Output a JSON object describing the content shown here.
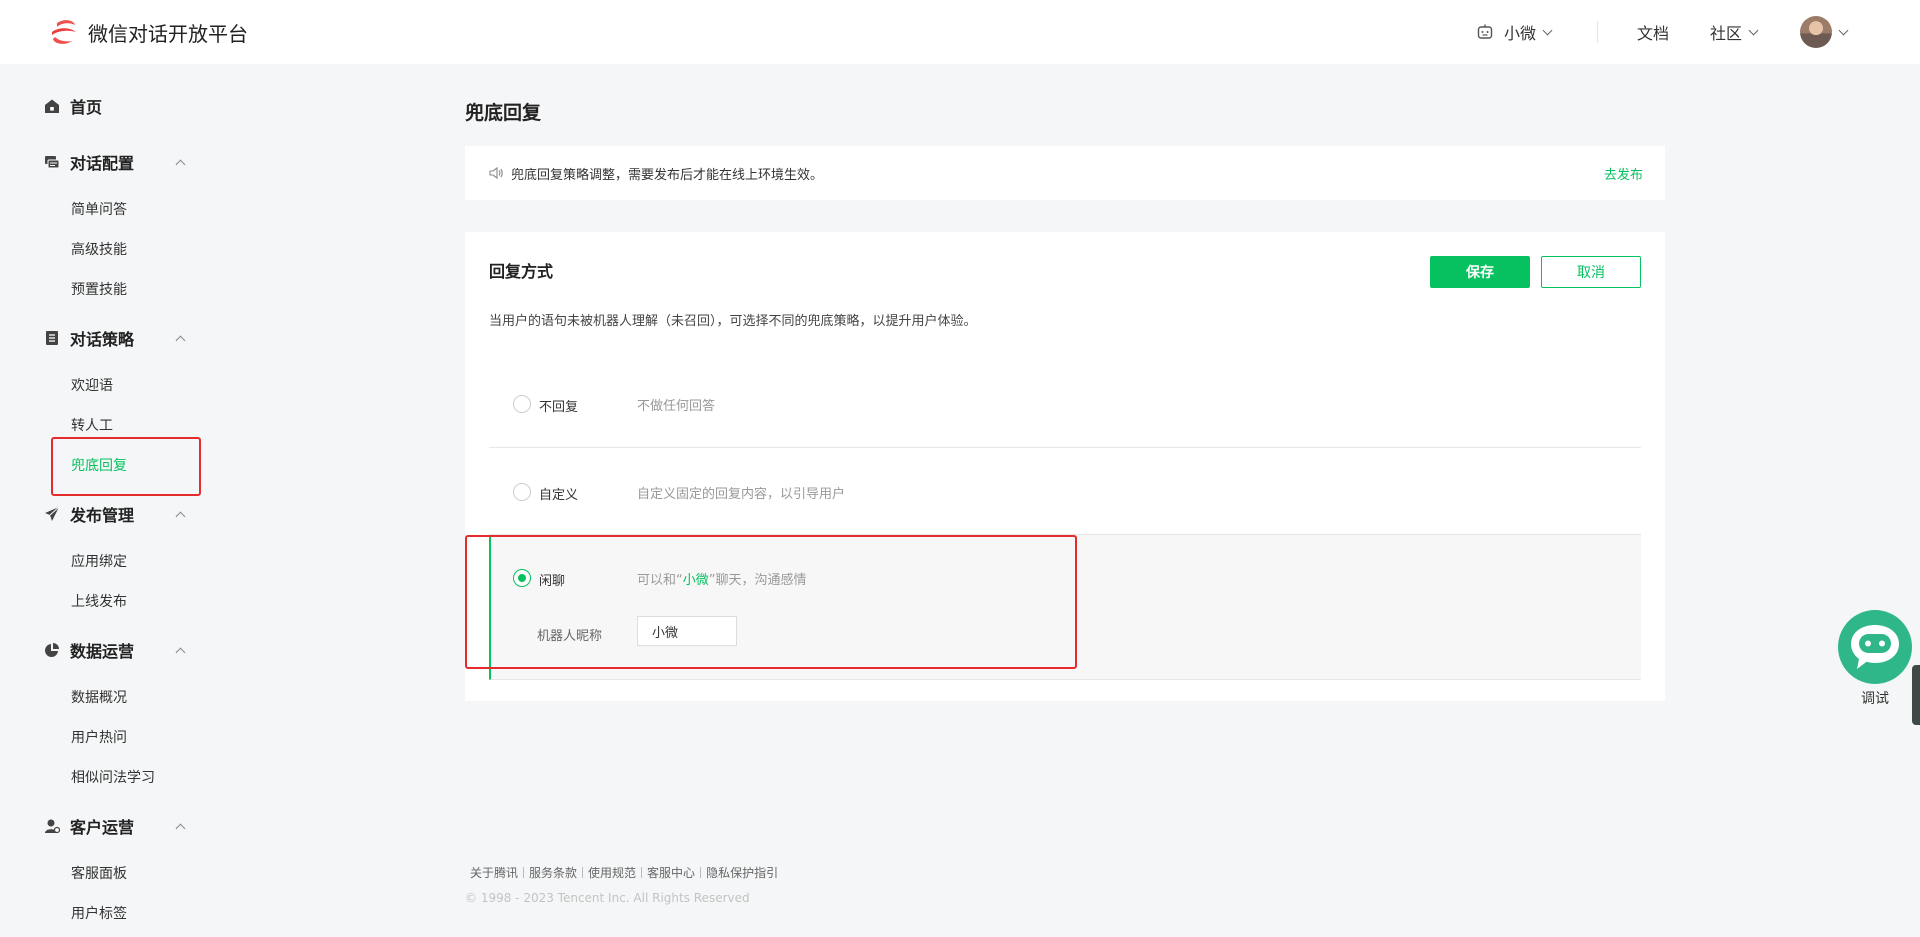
{
  "header": {
    "brand": "微信对话开放平台",
    "bot_name": "小微",
    "docs": "文档",
    "community": "社区"
  },
  "sidebar": {
    "groups": [
      {
        "label": "首页",
        "icon": "home-icon",
        "items": []
      },
      {
        "label": "对话配置",
        "icon": "chat-config-icon",
        "items": [
          "简单问答",
          "高级技能",
          "预置技能"
        ]
      },
      {
        "label": "对话策略",
        "icon": "strategy-icon",
        "items": [
          "欢迎语",
          "转人工",
          "兜底回复"
        ]
      },
      {
        "label": "发布管理",
        "icon": "send-icon",
        "items": [
          "应用绑定",
          "上线发布"
        ]
      },
      {
        "label": "数据运营",
        "icon": "pie-chart-icon",
        "items": [
          "数据概况",
          "用户热问",
          "相似问法学习"
        ]
      },
      {
        "label": "客户运营",
        "icon": "customer-icon",
        "items": [
          "客服面板",
          "用户标签"
        ]
      }
    ],
    "active_item": "兜底回复"
  },
  "main": {
    "title": "兜底回复",
    "notice": {
      "text": "兜底回复策略调整，需要发布后才能在线上环境生效。",
      "link": "去发布"
    },
    "card": {
      "title": "回复方式",
      "save": "保存",
      "cancel": "取消",
      "description": "当用户的语句未被机器人理解（未召回），可选择不同的兜底策略，以提升用户体验。",
      "options": [
        {
          "label": "不回复",
          "desc": "不做任何回答",
          "selected": false
        },
        {
          "label": "自定义",
          "desc": "自定义固定的回复内容，以引导用户",
          "selected": false
        },
        {
          "label": "闲聊",
          "desc_prefix": "可以和“",
          "desc_highlight": "小微",
          "desc_suffix": "”聊天，沟通感情",
          "selected": true
        }
      ],
      "nickname_label": "机器人昵称",
      "nickname_value": "小微"
    }
  },
  "footer": {
    "links": [
      "关于腾讯",
      "服务条款",
      "使用规范",
      "客服中心",
      "隐私保护指引"
    ],
    "copyright": "© 1998 - 2023 Tencent Inc. All Rights Reserved"
  },
  "debug": {
    "label": "调试"
  },
  "colors": {
    "accent": "#07c160",
    "highlight_box": "#e52b2b",
    "debug_bubble": "#2fb78a"
  }
}
